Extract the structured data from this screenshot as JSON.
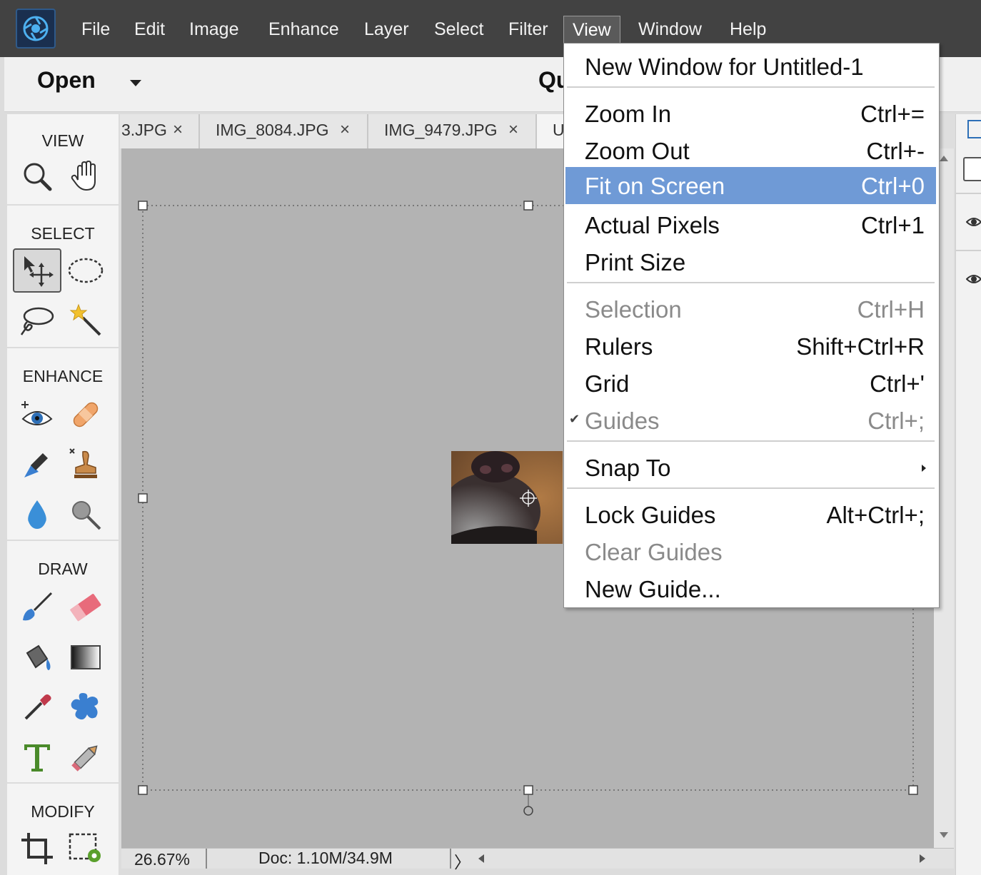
{
  "colors": {
    "menubar_bg": "#424242",
    "menu_highlight": "#6f9ad6",
    "canvas_bg": "#b3b3b3",
    "toolbox_bg": "#f4f4f4"
  },
  "menubar": {
    "items": [
      "File",
      "Edit",
      "Image",
      "Enhance",
      "Layer",
      "Select",
      "Filter",
      "View",
      "Window",
      "Help"
    ],
    "active": "View"
  },
  "options_bar": {
    "open_label": "Open",
    "mode_label": "Qu"
  },
  "tabs": [
    {
      "label": "3.JPG",
      "close": "×"
    },
    {
      "label": "IMG_8084.JPG",
      "close": "×"
    },
    {
      "label": "IMG_9479.JPG",
      "close": "×"
    },
    {
      "label": "U"
    }
  ],
  "toolbox": {
    "sections": [
      {
        "title": "VIEW",
        "tools": [
          "zoom-tool-icon",
          "hand-tool-icon"
        ]
      },
      {
        "title": "SELECT",
        "tools": [
          "move-tool-icon",
          "elliptical-marquee-icon",
          "lasso-icon",
          "magic-wand-icon"
        ]
      },
      {
        "title": "ENHANCE",
        "tools": [
          "red-eye-icon",
          "spot-healing-icon",
          "smart-brush-icon",
          "clone-stamp-icon",
          "blur-icon",
          "sponge-icon"
        ]
      },
      {
        "title": "DRAW",
        "tools": [
          "brush-icon",
          "eraser-icon",
          "paint-bucket-icon",
          "gradient-icon",
          "eyedropper-icon",
          "custom-shape-icon",
          "type-icon",
          "pencil-icon"
        ]
      },
      {
        "title": "MODIFY",
        "tools": [
          "crop-icon",
          "recompose-icon"
        ]
      }
    ],
    "selected_tool": "move-tool-icon"
  },
  "status": {
    "zoom": "26.67%",
    "doc": "Doc: 1.10M/34.9M",
    "arrow": "〉"
  },
  "view_menu": {
    "items": [
      {
        "label": "New Window for Untitled-1",
        "shortcut": ""
      },
      {
        "label": "Zoom In",
        "shortcut": "Ctrl+="
      },
      {
        "label": "Zoom Out",
        "shortcut": "Ctrl+-"
      },
      {
        "label": "Fit on Screen",
        "shortcut": "Ctrl+0",
        "highlighted": true
      },
      {
        "label": "Actual Pixels",
        "shortcut": "Ctrl+1"
      },
      {
        "label": "Print Size",
        "shortcut": ""
      },
      {
        "label": "Selection",
        "shortcut": "Ctrl+H",
        "disabled": true
      },
      {
        "label": "Rulers",
        "shortcut": "Shift+Ctrl+R"
      },
      {
        "label": "Grid",
        "shortcut": "Ctrl+'"
      },
      {
        "label": "Guides",
        "shortcut": "Ctrl+;",
        "disabled": true,
        "checked": true
      },
      {
        "label": "Snap To",
        "shortcut": "",
        "submenu": true
      },
      {
        "label": "Lock Guides",
        "shortcut": "Alt+Ctrl+;"
      },
      {
        "label": "Clear Guides",
        "shortcut": "",
        "disabled": true
      },
      {
        "label": "New Guide...",
        "shortcut": ""
      }
    ]
  }
}
